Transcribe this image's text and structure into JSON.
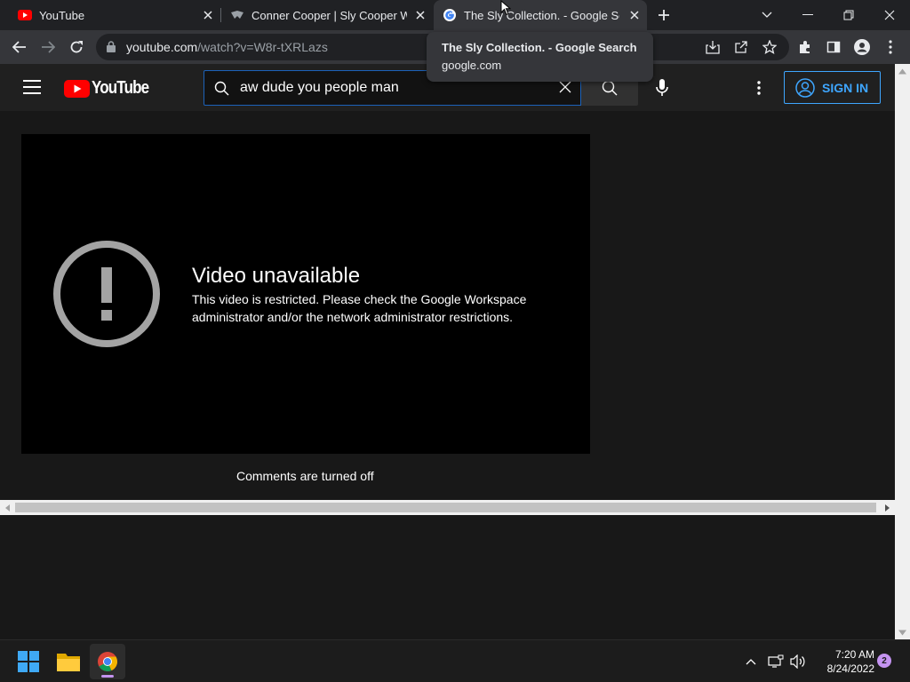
{
  "browser": {
    "tabs": [
      {
        "title": "YouTube",
        "favicon": "youtube-icon",
        "active": false
      },
      {
        "title": "Conner Cooper | Sly Cooper Wiki",
        "favicon": "fandom-icon",
        "active": false
      },
      {
        "title": "The Sly Collection. - Google Search",
        "favicon": "google-icon",
        "active": true
      }
    ],
    "address": {
      "domain": "youtube.com",
      "path": "/watch?v=W8r-tXRLazs"
    },
    "hovercard": {
      "title": "The Sly Collection. - Google Search",
      "domain": "google.com"
    }
  },
  "youtube": {
    "logo_text": "YouTube",
    "search_value": "aw dude you people man",
    "signin_label": "SIGN IN",
    "player": {
      "title": "Video unavailable",
      "message": "This video is restricted. Please check the Google Workspace administrator and/or the network administrator restrictions."
    },
    "comments_status": "Comments are turned off"
  },
  "taskbar": {
    "time": "7:20 AM",
    "date": "8/24/2022",
    "notification_count": "2"
  },
  "colors": {
    "accent_blue": "#3ea6ff",
    "youtube_red": "#ff0000",
    "notification": "#c493f0"
  }
}
